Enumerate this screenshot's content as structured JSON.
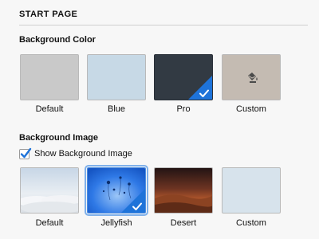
{
  "page": {
    "title": "START PAGE"
  },
  "background_color": {
    "title": "Background Color",
    "options": [
      {
        "label": "Default",
        "color": "#c9c9c9",
        "selected": false
      },
      {
        "label": "Blue",
        "color": "#c7d9e6",
        "selected": false
      },
      {
        "label": "Pro",
        "color": "#323a43",
        "selected": true
      },
      {
        "label": "Custom",
        "color": "#c4bbb2",
        "icon": "paint-bucket-icon",
        "selected": false
      }
    ]
  },
  "background_image": {
    "title": "Background Image",
    "show_checkbox": {
      "label": "Show Background Image",
      "checked": true
    },
    "options": [
      {
        "label": "Default",
        "thumbnail": "clouds-thumbnail",
        "selected": false
      },
      {
        "label": "Jellyfish",
        "thumbnail": "jellyfish-thumbnail",
        "selected": true
      },
      {
        "label": "Desert",
        "thumbnail": "desert-thumbnail",
        "selected": false
      },
      {
        "label": "Custom",
        "thumbnail": "custom-thumbnail",
        "selected": false
      }
    ]
  },
  "colors": {
    "accent": "#1e73d9"
  }
}
